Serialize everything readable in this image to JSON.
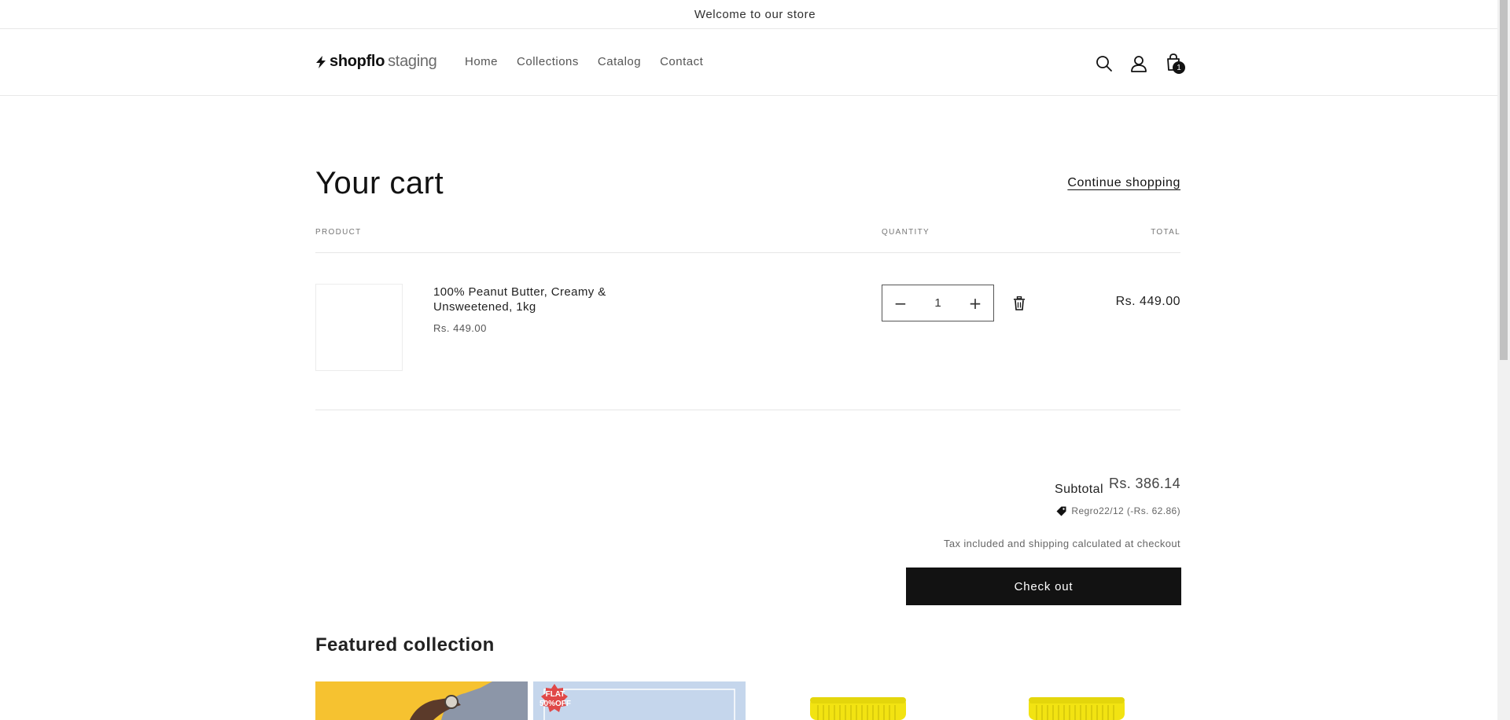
{
  "announcement": {
    "text": "Welcome to our store"
  },
  "header": {
    "logo_bold": "shopflo",
    "logo_light": "staging",
    "nav": [
      "Home",
      "Collections",
      "Catalog",
      "Contact"
    ],
    "icons": [
      "search-icon",
      "account-icon",
      "cart-icon"
    ],
    "cart_count": "1"
  },
  "cart": {
    "title": "Your cart",
    "continue_label": "Continue shopping",
    "columns": {
      "product": "Product",
      "quantity": "Quantity",
      "total": "Total"
    },
    "items": [
      {
        "name": "100% Peanut Butter, Creamy & Unsweetened, 1kg",
        "price": "Rs. 449.00",
        "quantity": "1",
        "total": "Rs. 449.00"
      }
    ],
    "qty_minus": "−",
    "qty_plus": "+"
  },
  "summary": {
    "subtotal_label": "Subtotal",
    "subtotal_value": "Rs. 386.14",
    "discount": "Regro22/12 (-Rs. 62.86)",
    "tax_note": "Tax included and shipping calculated at checkout",
    "checkout_label": "Check out"
  },
  "featured": {
    "title": "Featured collection",
    "badge_line1": "FLAT",
    "badge_line2": "50%OFF"
  },
  "colors": {
    "primary": "#121212",
    "card_yellow": "#f6c230",
    "card_blue": "#c5d6ec",
    "jar_yellow": "#f2e312"
  }
}
